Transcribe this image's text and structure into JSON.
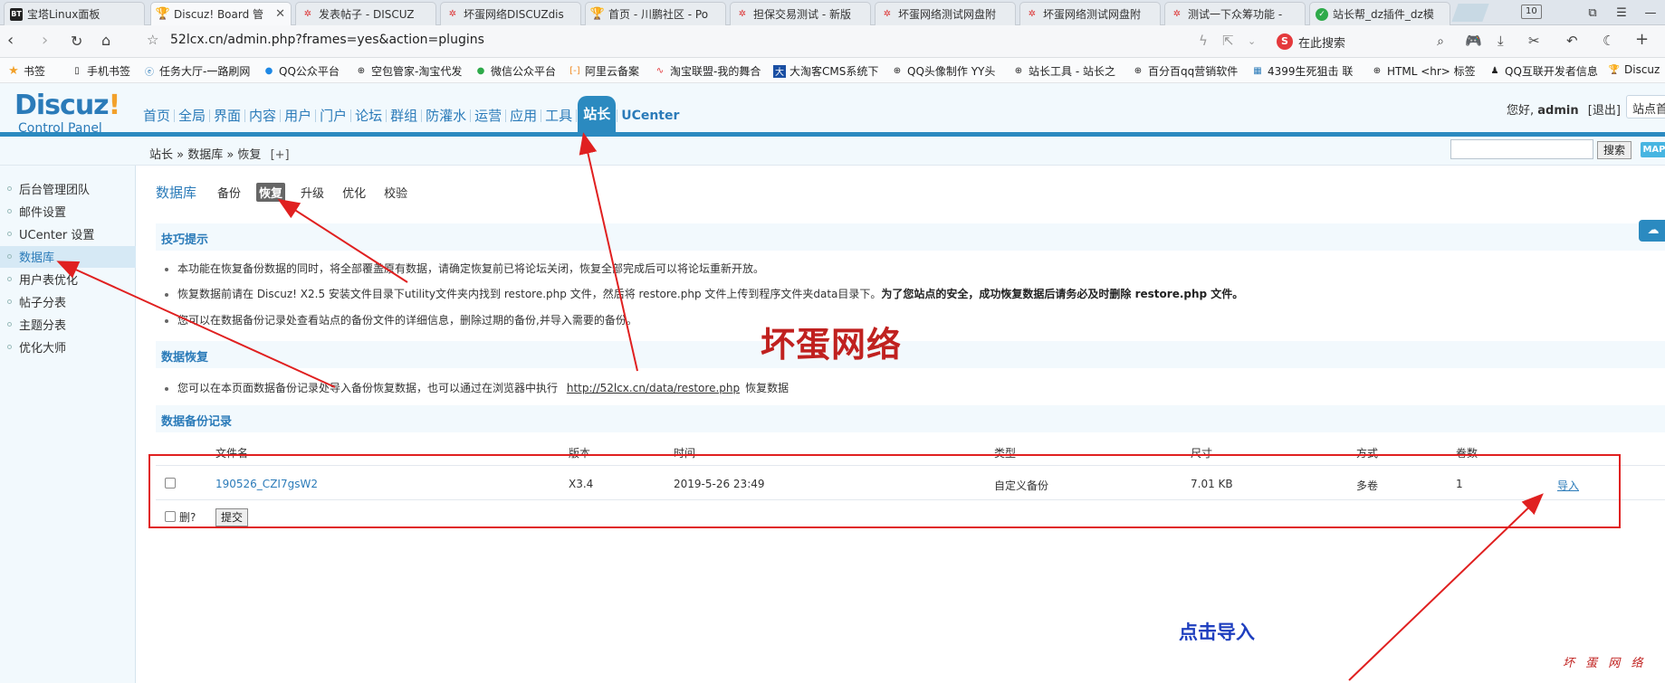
{
  "tabs": [
    {
      "title": "宝塔Linux面板",
      "fav": "BT",
      "active": false
    },
    {
      "title": "Discuz! Board 管",
      "fav": "trophy",
      "active": true
    },
    {
      "title": "发表帖子 - DISCUZ",
      "fav": "dz",
      "active": false
    },
    {
      "title": "坏蛋网络DISCUZdis",
      "fav": "dz",
      "active": false
    },
    {
      "title": "首页 - 川鹏社区 - Po",
      "fav": "trophy",
      "active": false
    },
    {
      "title": "担保交易测试 - 新版",
      "fav": "dz",
      "active": false
    },
    {
      "title": "坏蛋网络测试网盘附",
      "fav": "dz",
      "active": false
    },
    {
      "title": "坏蛋网络测试网盘附",
      "fav": "dz",
      "active": false
    },
    {
      "title": "测试一下众筹功能 -",
      "fav": "dz",
      "active": false
    },
    {
      "title": "站长帮_dz插件_dz模",
      "fav": "check",
      "active": false
    }
  ],
  "tab_count": "10",
  "address": {
    "url": "52lcx.cn/admin.php?frames=yes&action=plugins",
    "search_placeholder": "在此搜索"
  },
  "bookmarks": [
    "书签",
    "手机书签",
    "任务大厅-一路刷网",
    "QQ公众平台",
    "空包管家-淘宝代发",
    "微信公众平台",
    "阿里云备案",
    "淘宝联盟-我的舞合",
    "大淘客CMS系统下",
    "QQ头像制作 YY头",
    "站长工具 - 站长之",
    "百分百qq营销软件",
    "4399生死狙击 联",
    "HTML <hr> 标签",
    "QQ互联开发者信息",
    "Discuz"
  ],
  "logo": {
    "brand": "Discuz",
    "exclaim": "!",
    "subtitle": "Control Panel"
  },
  "main_nav": [
    "首页",
    "全局",
    "界面",
    "内容",
    "用户",
    "门户",
    "论坛",
    "群组",
    "防灌水",
    "运营",
    "应用",
    "工具",
    "站长",
    "UCenter"
  ],
  "main_nav_current": 12,
  "user": {
    "greeting": "您好,",
    "name": "admin",
    "logout": "[退出]",
    "site_home": "站点首页"
  },
  "breadcrumb": {
    "text": "站长 » 数据库 » 恢复",
    "plus": "[+]"
  },
  "search_btn": "搜索",
  "map_btn": "MAP",
  "sidebar": [
    "后台管理团队",
    "邮件设置",
    "UCenter 设置",
    "数据库",
    "用户表优化",
    "帖子分表",
    "主题分表",
    "优化大师"
  ],
  "sidebar_current": 3,
  "subnav": {
    "heading": "数据库",
    "items": [
      "备份",
      "恢复",
      "升级",
      "优化",
      "校验"
    ],
    "current": 1
  },
  "tips": {
    "title": "技巧提示",
    "items": [
      {
        "text": "本功能在恢复备份数据的同时，将全部覆盖原有数据，请确定恢复前已将论坛关闭，恢复全部完成后可以将论坛重新开放。",
        "bold": ""
      },
      {
        "text": "恢复数据前请在 Discuz! X2.5 安装文件目录下utility文件夹内找到 restore.php 文件，然后将 restore.php 文件上传到程序文件夹data目录下。",
        "bold": "为了您站点的安全，成功恢复数据后请务必及时删除 restore.php 文件。"
      },
      {
        "text": "您可以在数据备份记录处查看站点的备份文件的详细信息，删除过期的备份,并导入需要的备份。",
        "bold": ""
      }
    ]
  },
  "restore": {
    "title": "数据恢复",
    "text_before": "您可以在本页面数据备份记录处导入备份恢复数据，也可以通过在浏览器中执行",
    "link": "http://52lcx.cn/data/restore.php",
    "text_after": "恢复数据"
  },
  "backups": {
    "title": "数据备份记录",
    "columns": [
      "文件名",
      "版本",
      "时间",
      "类型",
      "尺寸",
      "方式",
      "卷数"
    ],
    "rows": [
      {
        "name": "190526_CZI7gsW2",
        "version": "X3.4",
        "time": "2019-5-26 23:49",
        "type": "自定义备份",
        "size": "7.01 KB",
        "method": "多卷",
        "volumes": "1",
        "action": "导入"
      }
    ],
    "delete_label": "删?",
    "submit": "提交"
  },
  "annotations": {
    "watermark": "坏蛋网络",
    "click_hint": "点击导入",
    "footer_watermark": "坏 蛋 网 络"
  },
  "colors": {
    "accent": "#2b8ac0",
    "link": "#2b7bb9",
    "annotation_red": "#e02020",
    "annotation_blue": "#1f3fbf"
  }
}
